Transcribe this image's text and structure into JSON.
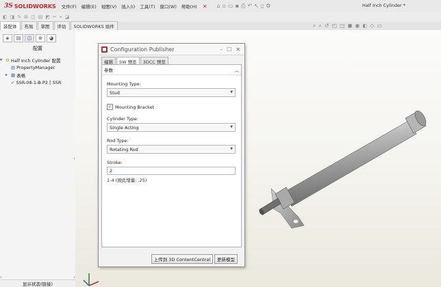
{
  "app": {
    "brand_prefix": "3S",
    "brand_name": "SOLIDWORKS",
    "menus": [
      "文件(F)",
      "编辑(E)",
      "视图(V)",
      "插入(I)",
      "工具(T)",
      "窗口(W)",
      "帮助(H)"
    ],
    "document_title": "Half Inch Cylinder *"
  },
  "command_tabs": [
    "装配体",
    "布局",
    "草图",
    "评估",
    "SOLIDWORKS 插件"
  ],
  "left_panel": {
    "title": "配置",
    "tree": [
      {
        "label": "Half Inch Cylinder 配置",
        "expander": "▾"
      },
      {
        "label": "PropertyManager",
        "expander": ""
      },
      {
        "label": "表格",
        "expander": "▸"
      },
      {
        "label": "SSR-08-1-B-P2 [ SSR",
        "expander": ""
      }
    ],
    "display_status": "显示状态(链接)"
  },
  "dialog": {
    "title": "Configuration Publisher",
    "tabs": [
      "编辑",
      "SW 预览",
      "3DCC 预览"
    ],
    "section_header": "参数",
    "mounting_type_label": "Mounting Type:",
    "mounting_type_value": "Stud",
    "mounting_bracket_label": "Mounting Bracket",
    "mounting_bracket_checked": true,
    "cylinder_type_label": "Cylinder Type:",
    "cylinder_type_value": "Single Acting",
    "rod_type_label": "Rod Type:",
    "rod_type_value": "Rotating Rod",
    "stroke_label": "Stroke:",
    "stroke_value": "2",
    "stroke_hint": "1-4 (按此增量: .25)",
    "upload_button": "上传到 3D ContentCentral",
    "update_button": "更新模型"
  },
  "colors": {
    "accent": "#c62828",
    "viewport_bg": "#f6f5f1"
  }
}
